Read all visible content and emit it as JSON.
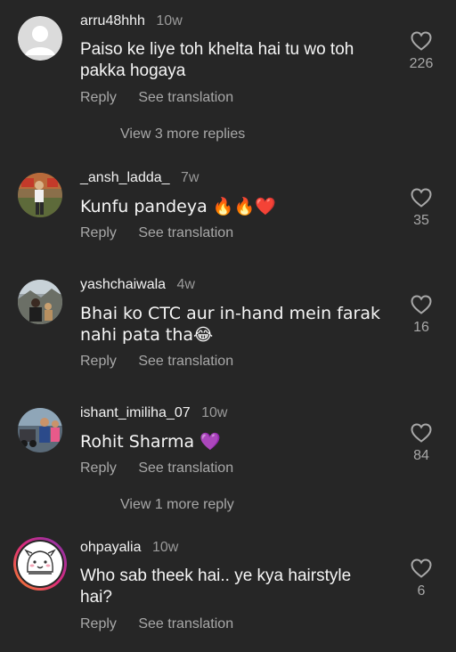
{
  "labels": {
    "reply": "Reply",
    "see_translation": "See translation"
  },
  "comments": [
    {
      "username": "arru48hhh",
      "time": "10w",
      "text": "Paiso ke liye toh khelta hai tu wo toh pakka hogaya",
      "likes": "226",
      "avatar_icon": "default-avatar-icon",
      "view_more": "View 3 more replies"
    },
    {
      "username": "_ansh_ladda_",
      "time": "7w",
      "text": "Kunfu pandeya 🔥🔥❤️",
      "likes": "35",
      "avatar_icon": "photo-avatar"
    },
    {
      "username": "yashchaiwala",
      "time": "4w",
      "text": "Bhai ko CTC aur in-hand mein farak nahi pata tha😂",
      "likes": "16",
      "avatar_icon": "photo-avatar"
    },
    {
      "username": "ishant_imiliha_07",
      "time": "10w",
      "text": "Rohit Sharma 💜",
      "likes": "84",
      "avatar_icon": "photo-avatar",
      "view_more": "View 1 more reply"
    },
    {
      "username": "ohpayalia",
      "time": "10w",
      "text": "Who sab theek hai.. ye kya hairstyle hai?",
      "likes": "6",
      "avatar_icon": "cartoon-avatar-with-story-ring"
    }
  ],
  "colors": {
    "background": "#262626",
    "secondary_text": "#a8a8a8",
    "story_ring_start": "#f58529",
    "story_ring_end": "#dd2a7b"
  }
}
